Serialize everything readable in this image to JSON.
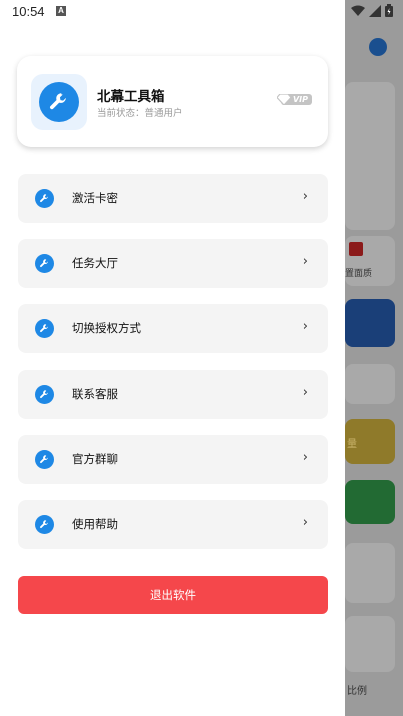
{
  "status_bar": {
    "time": "10:54",
    "notification_badge": "A"
  },
  "drawer": {
    "profile": {
      "app_name": "北幕工具箱",
      "status_text": "当前状态：普通用户",
      "badge": "VIP"
    },
    "menu_items": [
      {
        "label": "激活卡密",
        "icon": "wrench-icon"
      },
      {
        "label": "任务大厅",
        "icon": "wrench-icon"
      },
      {
        "label": "切换授权方式",
        "icon": "wrench-icon"
      },
      {
        "label": "联系客服",
        "icon": "wrench-icon"
      },
      {
        "label": "官方群聊",
        "icon": "wrench-icon"
      },
      {
        "label": "使用帮助",
        "icon": "wrench-icon"
      }
    ],
    "chevron": "›",
    "exit_label": "退出软件"
  },
  "background_app": {
    "label_1": "置面质",
    "label_2": "量",
    "label_3": "比例"
  },
  "colors": {
    "accent": "#1e88e5",
    "exit": "#f5474b",
    "menu_bg": "#f4f4f4"
  }
}
